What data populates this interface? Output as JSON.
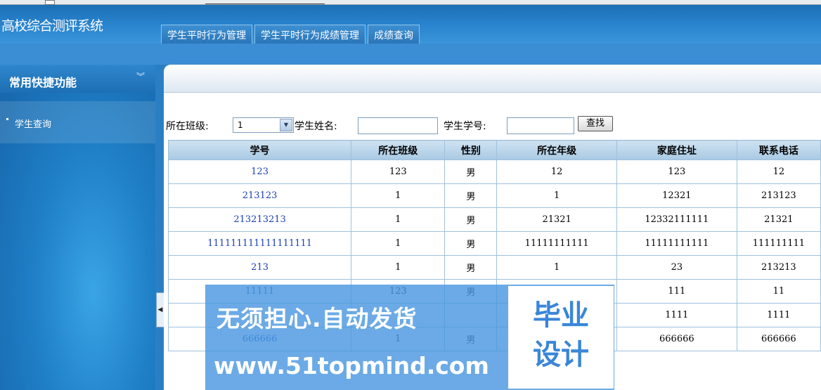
{
  "app_title": "高校综合测评系统",
  "tabs": [
    "学生平时行为管理",
    "学生平时行为成绩管理",
    "成绩查询"
  ],
  "sidebar": {
    "title": "常用快捷功能",
    "items": [
      "学生查询"
    ]
  },
  "search": {
    "class_label": "所在班级:",
    "class_value": "1",
    "name_label": "学生姓名:",
    "name_value": "",
    "id_label": "学生学号:",
    "id_value": "",
    "button": "查找"
  },
  "table": {
    "headers": [
      "学号",
      "所在班级",
      "性别",
      "所在年级",
      "家庭住址",
      "联系电话"
    ],
    "rows": [
      [
        "123",
        "123",
        "男",
        "12",
        "123",
        "12"
      ],
      [
        "213123",
        "1",
        "男",
        "1",
        "12321",
        "213123"
      ],
      [
        "213213213",
        "1",
        "男",
        "21321",
        "12332111111",
        "21321"
      ],
      [
        "111111111111111111",
        "1",
        "男",
        "11111111111",
        "11111111111",
        "111111111"
      ],
      [
        "213",
        "1",
        "男",
        "1",
        "23",
        "213213"
      ],
      [
        "11111",
        "123",
        "男",
        "1111111",
        "111",
        "11"
      ],
      [
        "",
        "",
        "",
        "",
        "1111",
        "1111"
      ],
      [
        "666666",
        "1",
        "男",
        "666666",
        "666666",
        "666666"
      ]
    ]
  },
  "watermark": {
    "line1": "无须担心.自动发货",
    "line2": "www.51topmind.com",
    "badge_line1": "毕业",
    "badge_line2": "设计"
  }
}
